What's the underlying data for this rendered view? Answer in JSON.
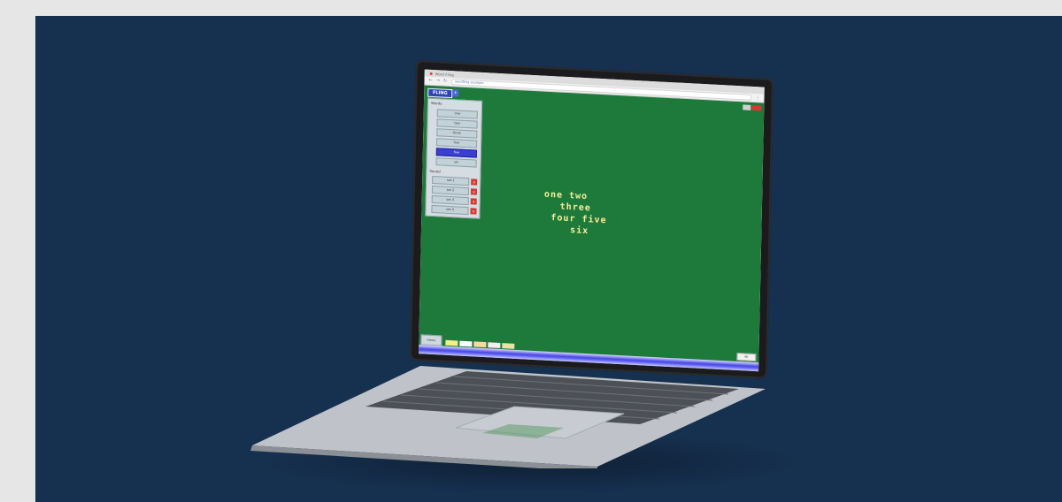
{
  "browser": {
    "tab_title": "Word Fling",
    "url": "wordfling.example"
  },
  "app": {
    "logo_text": "FLING",
    "logo_badge": "+",
    "panel": {
      "title": "Words",
      "buttons": [
        "one",
        "two",
        "three",
        "four",
        "five",
        "six"
      ],
      "active_index": 4,
      "sub_title": "Saved",
      "saved_rows": [
        "set 1",
        "set 2",
        "set 3",
        "set 4"
      ],
      "delete_label": "x"
    },
    "canvas_words": {
      "line1": "one two",
      "line2": "three",
      "line3": "four five",
      "line4": "six"
    },
    "bottom_left_label": "menu",
    "status_right_label": "ok",
    "swatch_colors": [
      "#f3f08a",
      "#ffffff",
      "#f8d9a0",
      "#f0f0f0",
      "#e8e3a0"
    ],
    "colors": {
      "background": "#16304f",
      "canvas": "#1d7a3a",
      "word_text": "#f4f09a",
      "status_bar": "#4a4ae6",
      "close": "#d33a34"
    }
  }
}
